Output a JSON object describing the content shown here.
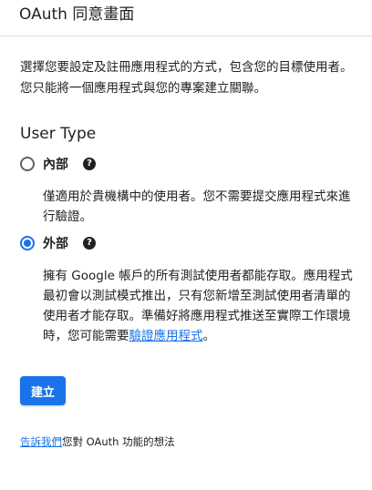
{
  "header": {
    "title": "OAuth 同意畫面"
  },
  "intro": {
    "text": "選擇您要設定及註冊應用程式的方式，包含您的目標使用者。您只能將一個應用程式與您的專案建立關聯。"
  },
  "user_type": {
    "title": "User Type",
    "options": [
      {
        "label": "內部",
        "selected": false,
        "help_icon": "question-circle-icon",
        "description": "僅適用於貴機構中的使用者。您不需要提交應用程式來進行驗證。"
      },
      {
        "label": "外部",
        "selected": true,
        "help_icon": "question-circle-icon",
        "description_before": "擁有 Google 帳戶的所有測試使用者都能存取。應用程式最初會以測試模式推出，只有您新增至測試使用者清單的使用者才能存取。準備好將應用程式推送至實際工作環境時，您可能需要",
        "description_link": "驗證應用程式",
        "description_after": "。"
      }
    ]
  },
  "actions": {
    "create_label": "建立"
  },
  "feedback": {
    "link_text": "告訴我們",
    "rest_text": "您對 OAuth 功能的想法"
  },
  "colors": {
    "accent": "#1a73e8",
    "text": "#202124",
    "divider": "#dadce0"
  }
}
